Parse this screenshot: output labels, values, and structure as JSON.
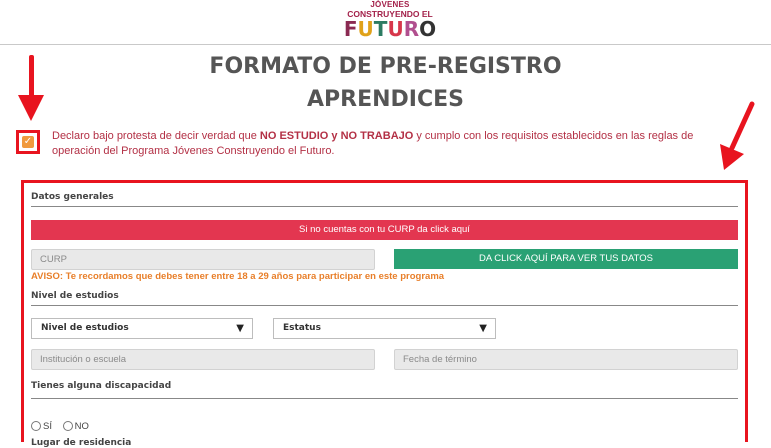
{
  "logo": {
    "line1": "JÓVENES",
    "line2": "CONSTRUYENDO EL",
    "word": [
      "F",
      "U",
      "T",
      "U",
      "R",
      "O"
    ]
  },
  "title": {
    "line1": "FORMATO DE PRE-REGISTRO",
    "line2": "APRENDICES"
  },
  "declaration": {
    "checked": true,
    "text_before": "Declaro bajo protesta de decir verdad que ",
    "bold": "NO ESTUDIO y NO TRABAJO",
    "text_after": " y cumplo con los requisitos establecidos en las reglas de operación del Programa Jóvenes Construyendo el Futuro."
  },
  "form": {
    "general_title": "Datos generales",
    "no_curp_banner": "Si no cuentas con tu CURP da click aquí",
    "curp_placeholder": "CURP",
    "view_data_button": "DA CLICK AQUÍ PARA VER TUS DATOS",
    "age_notice": "AVISO: Te recordamos que debes tener entre 18 a 29 años para participar en este programa",
    "education_title": "Nivel de estudios",
    "education_select": "Nivel de estudios",
    "status_select": "Estatus",
    "institution_placeholder": "Institución o escuela",
    "end_date_placeholder": "Fecha de término",
    "disability_title": "Tienes alguna discapacidad",
    "yes_label": "SÍ",
    "no_label": "NO",
    "residence_title": "Lugar de residencia"
  },
  "colors": {
    "alert_red": "#e8141f",
    "banner_red": "#e33650",
    "green": "#2aa174",
    "notice_orange": "#e87f2a",
    "declaration_text": "#b33045"
  },
  "icons": {
    "checkbox": "check-icon",
    "select_caret": "triangle-down-icon",
    "annotation": "red-arrow-icon"
  }
}
